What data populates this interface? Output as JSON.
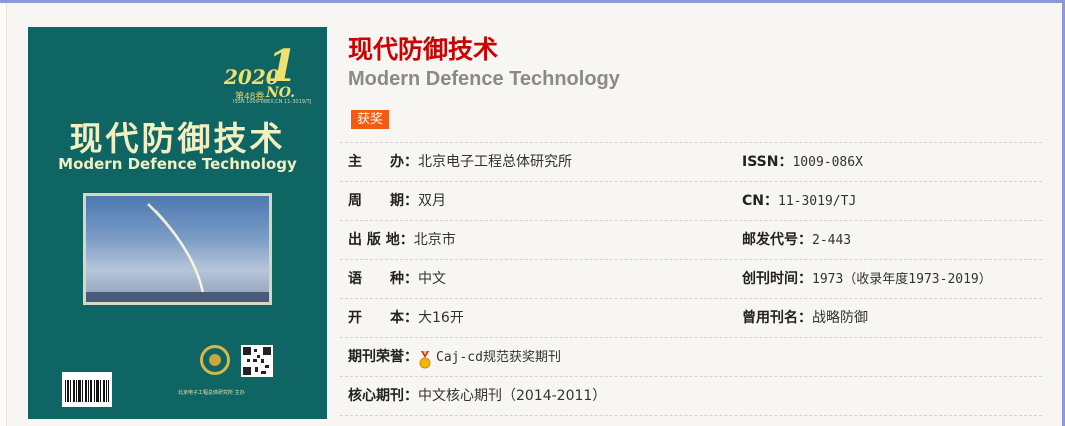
{
  "journal": {
    "title_cn": "现代防御技术",
    "title_en": "Modern Defence Technology",
    "badge": "获奖"
  },
  "cover": {
    "year": "2020",
    "issue_number": "1",
    "volume": "第48卷",
    "no_label": "NO.",
    "issn_line": "ISSN 1009-086X,CN 11-3019/TJ",
    "title_cn": "现代防御技术",
    "title_en": "Modern Defence Technology",
    "publisher_line": "北京电子工程总体研究所  主办"
  },
  "info": [
    {
      "label": "主　　办：",
      "value": "北京电子工程总体研究所",
      "label2": "ISSN：",
      "value2": "1009-086X"
    },
    {
      "label": "周　　期：",
      "value": "双月",
      "label2": "CN：",
      "value2": "11-3019/TJ"
    },
    {
      "label": "出 版 地：",
      "value": "北京市",
      "label2": "邮发代号：",
      "value2": "2-443"
    },
    {
      "label": "语　　种：",
      "value": "中文",
      "label2": "创刊时间：",
      "value2": "1973（收录年度1973-2019）"
    },
    {
      "label": "开　　本：",
      "value": "大16开",
      "label2": "曾用刊名：",
      "value2": "战略防御"
    },
    {
      "label": "期刊荣誉：",
      "value": "Caj-cd规范获奖期刊",
      "label2": "",
      "value2": ""
    },
    {
      "label": "核心期刊：",
      "value": "中文核心期刊（2014-2011）",
      "label2": "",
      "value2": ""
    }
  ]
}
